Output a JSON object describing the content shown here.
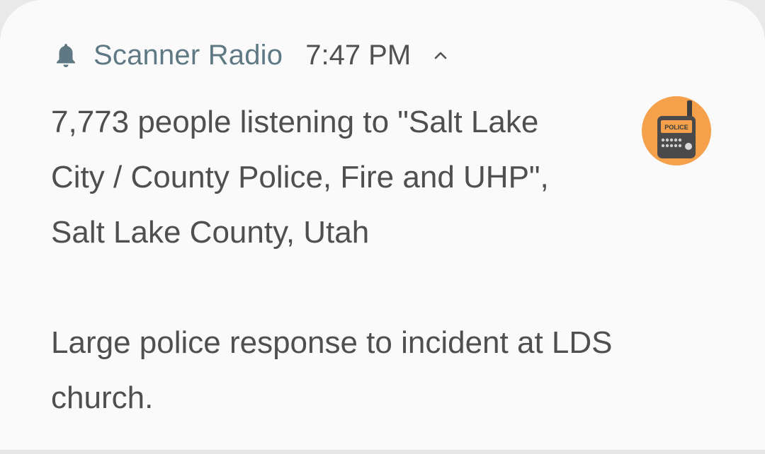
{
  "notification": {
    "app_name": "Scanner Radio",
    "time": "7:47 PM",
    "icons": {
      "header": "bell-icon",
      "expand": "chevron-up-icon",
      "app": "police-scanner-icon"
    },
    "app_icon_label": "POLICE",
    "colors": {
      "accent": "#5f7984",
      "app_icon_bg": "#f5a04a",
      "scanner_body": "#4a4a4a"
    },
    "lines": [
      "7,773 people listening to \"Salt Lake",
      "City / County Police, Fire and UHP\",",
      "Salt Lake County, Utah"
    ],
    "message_lines": [
      "Large police response to incident at LDS",
      "church."
    ]
  }
}
